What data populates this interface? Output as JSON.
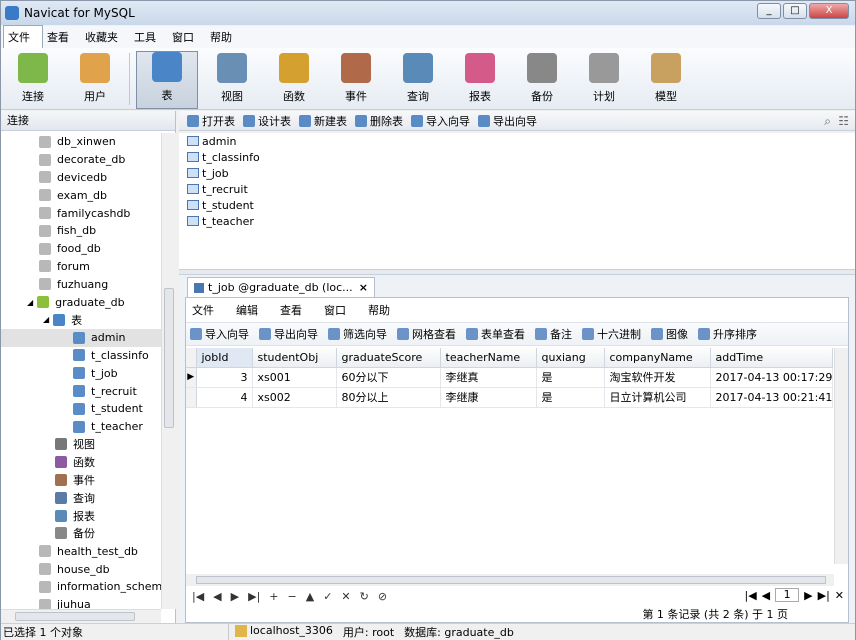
{
  "window": {
    "title": "Navicat for MySQL",
    "buttons": [
      "_",
      "□",
      "X"
    ]
  },
  "menu": [
    "文件",
    "查看",
    "收藏夹",
    "工具",
    "窗口",
    "帮助"
  ],
  "toolbar": [
    {
      "label": "连接",
      "icon": "connection-icon",
      "color": "#7fb84a"
    },
    {
      "label": "用户",
      "icon": "user-icon",
      "color": "#e0a24a"
    },
    {
      "label": "表",
      "icon": "table-icon",
      "color": "#4a85c8",
      "selected": true
    },
    {
      "label": "视图",
      "icon": "view-icon",
      "color": "#6a8fb5"
    },
    {
      "label": "函数",
      "icon": "function-icon",
      "color": "#d4a030"
    },
    {
      "label": "事件",
      "icon": "event-icon",
      "color": "#b06a4a"
    },
    {
      "label": "查询",
      "icon": "query-icon",
      "color": "#5a8ab8"
    },
    {
      "label": "报表",
      "icon": "report-icon",
      "color": "#d45a8a"
    },
    {
      "label": "备份",
      "icon": "backup-icon",
      "color": "#888888"
    },
    {
      "label": "计划",
      "icon": "schedule-icon",
      "color": "#999999"
    },
    {
      "label": "模型",
      "icon": "model-icon",
      "color": "#c8a060"
    }
  ],
  "left": {
    "header": "连接",
    "tree": [
      {
        "label": "db_xinwen",
        "indent": 1,
        "icon": "database-icon"
      },
      {
        "label": "decorate_db",
        "indent": 1,
        "icon": "database-icon"
      },
      {
        "label": "devicedb",
        "indent": 1,
        "icon": "database-icon"
      },
      {
        "label": "exam_db",
        "indent": 1,
        "icon": "database-icon"
      },
      {
        "label": "familycashdb",
        "indent": 1,
        "icon": "database-icon"
      },
      {
        "label": "fish_db",
        "indent": 1,
        "icon": "database-icon"
      },
      {
        "label": "food_db",
        "indent": 1,
        "icon": "database-icon"
      },
      {
        "label": "forum",
        "indent": 1,
        "icon": "database-icon"
      },
      {
        "label": "fuzhuang",
        "indent": 1,
        "icon": "database-icon"
      },
      {
        "label": "graduate_db",
        "indent": 1,
        "icon": "database-open-icon",
        "open": true
      },
      {
        "label": "表",
        "indent": 2,
        "icon": "tables-folder-icon",
        "open": true
      },
      {
        "label": "admin",
        "indent": 3,
        "icon": "table-icon",
        "selected": true
      },
      {
        "label": "t_classinfo",
        "indent": 3,
        "icon": "table-icon"
      },
      {
        "label": "t_job",
        "indent": 3,
        "icon": "table-icon"
      },
      {
        "label": "t_recruit",
        "indent": 3,
        "icon": "table-icon"
      },
      {
        "label": "t_student",
        "indent": 3,
        "icon": "table-icon"
      },
      {
        "label": "t_teacher",
        "indent": 3,
        "icon": "table-icon"
      },
      {
        "label": "视图",
        "indent": 2,
        "icon": "view-icon"
      },
      {
        "label": "函数",
        "indent": 2,
        "icon": "function-icon"
      },
      {
        "label": "事件",
        "indent": 2,
        "icon": "event-icon"
      },
      {
        "label": "查询",
        "indent": 2,
        "icon": "query-icon"
      },
      {
        "label": "报表",
        "indent": 2,
        "icon": "report-icon"
      },
      {
        "label": "备份",
        "indent": 2,
        "icon": "backup-icon"
      },
      {
        "label": "health_test_db",
        "indent": 1,
        "icon": "database-icon"
      },
      {
        "label": "house_db",
        "indent": 1,
        "icon": "database-icon"
      },
      {
        "label": "information_schema",
        "indent": 1,
        "icon": "database-icon"
      },
      {
        "label": "jiuhua",
        "indent": 1,
        "icon": "database-icon"
      }
    ]
  },
  "objbar": [
    "打开表",
    "设计表",
    "新建表",
    "删除表",
    "导入向导",
    "导出向导"
  ],
  "objects": [
    "admin",
    "t_classinfo",
    "t_job",
    "t_recruit",
    "t_student",
    "t_teacher"
  ],
  "tab": {
    "label": "t_job @graduate_db (loc...",
    "close": "×"
  },
  "inner_menu": [
    "文件",
    "编辑",
    "查看",
    "窗口",
    "帮助"
  ],
  "inner_toolbar": [
    "导入向导",
    "导出向导",
    "筛选向导",
    "网格查看",
    "表单查看",
    "备注",
    "十六进制",
    "图像",
    "升序排序"
  ],
  "grid": {
    "columns": [
      "jobId",
      "studentObj",
      "graduateScore",
      "teacherName",
      "quxiang",
      "companyName",
      "addTime"
    ],
    "rows": [
      [
        "3",
        "xs001",
        "60分以下",
        "李继真",
        "是",
        "淘宝软件开发",
        "2017-04-13 00:17:29"
      ],
      [
        "4",
        "xs002",
        "80分以上",
        "李继康",
        "是",
        "日立计算机公司",
        "2017-04-13 00:21:41"
      ]
    ]
  },
  "pager": {
    "page": "1",
    "record_info": "第 1 条记录 (共 2 条) 于 1 页"
  },
  "status": {
    "selected": "已选择 1 个对象",
    "host": "localhost_3306",
    "user": "用户: root",
    "db": "数据库: graduate_db"
  }
}
